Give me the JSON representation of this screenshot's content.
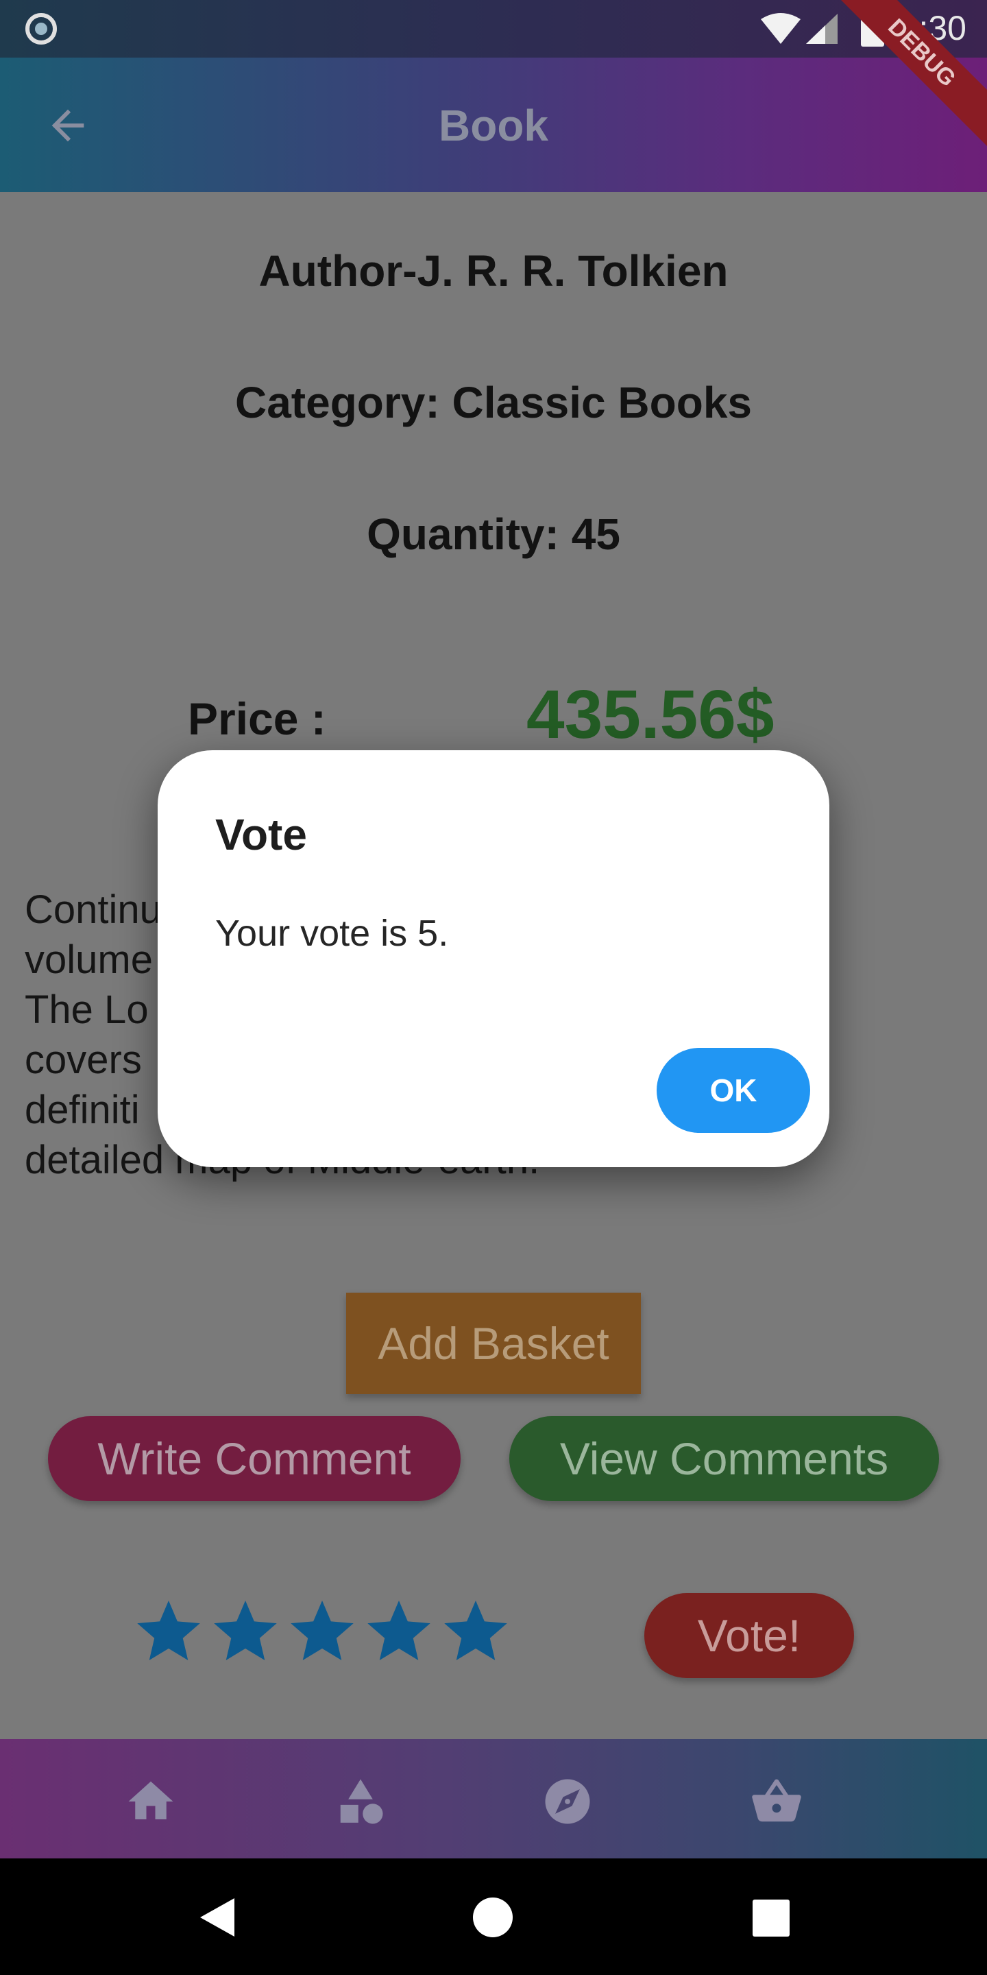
{
  "status_bar": {
    "time": "1:30"
  },
  "debug_banner": {
    "label": "DEBUG"
  },
  "app_bar": {
    "title": "Book"
  },
  "book": {
    "author": "Author-J. R. R. Tolkien",
    "category": "Category: Classic Books",
    "quantity": "Quantity: 45",
    "price_label": "Price :",
    "price_value": "435.56$",
    "description": "Continu                                               ree-\nvolume                                               piece,\nThe Lo                                                 ck\ncovers\ndefiniti\ndetailed map of Middle-earth."
  },
  "buttons": {
    "add_basket": "Add Basket",
    "write_comment": "Write Comment",
    "view_comments": "View Comments",
    "vote": "Vote!"
  },
  "rating": {
    "stars": 5,
    "max": 5,
    "color": "#0d5a8f"
  },
  "dialog": {
    "title": "Vote",
    "message": "Your vote is 5.",
    "ok_label": "OK",
    "ok_color": "#2196f3"
  },
  "bottom_nav": {
    "items": [
      "home-icon",
      "shapes-icon",
      "compass-icon",
      "basket-icon"
    ]
  }
}
